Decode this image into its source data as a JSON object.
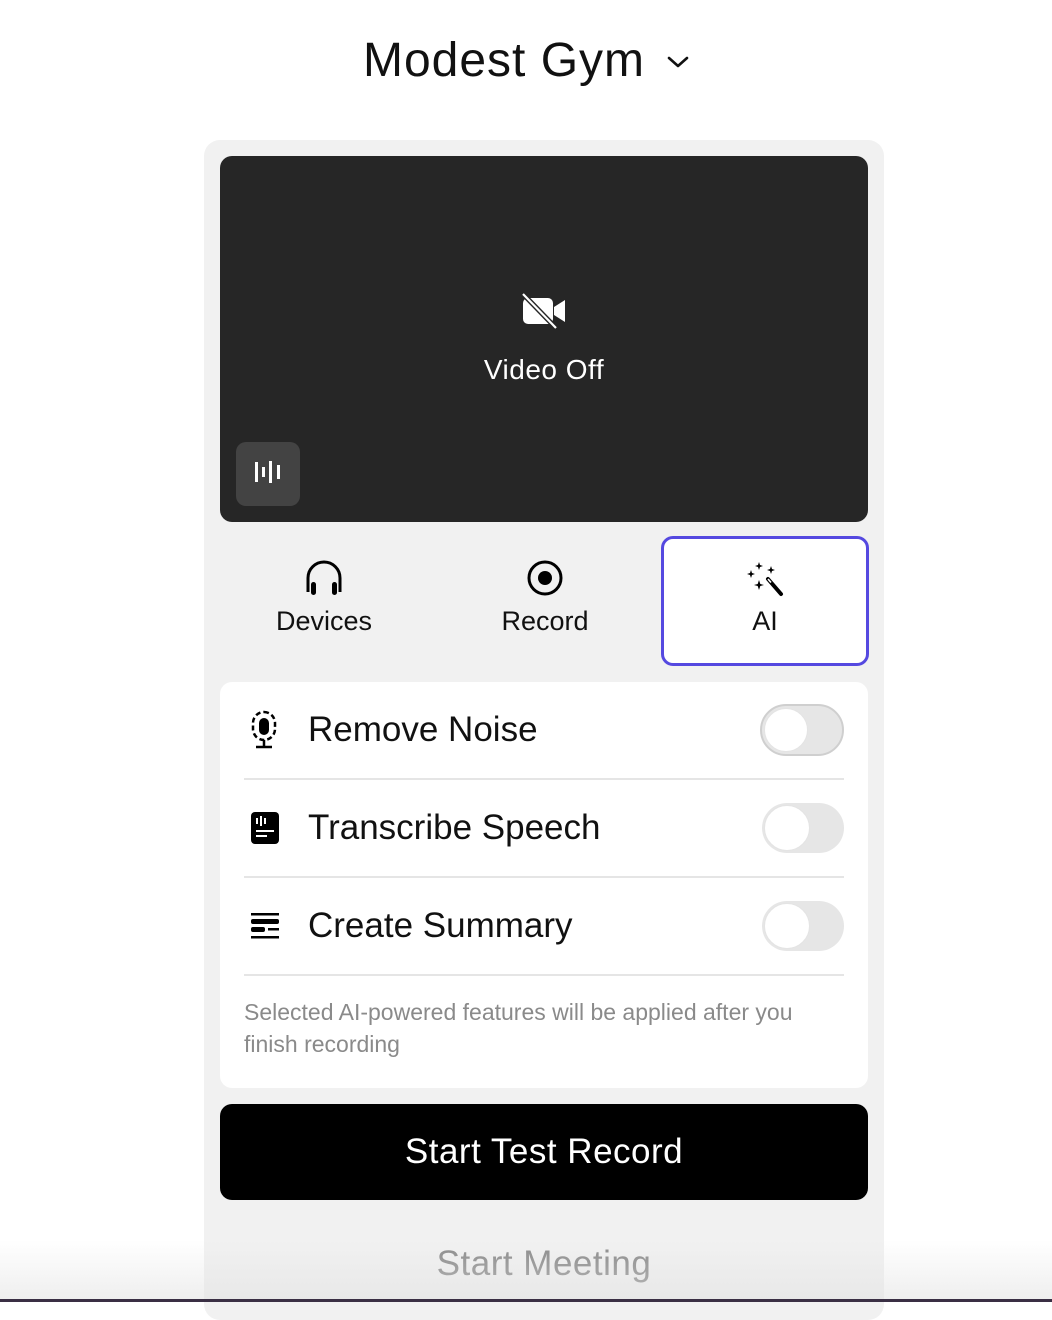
{
  "header": {
    "title": "Modest Gym",
    "dropdown_icon": "chevron-down-icon"
  },
  "video": {
    "status_label": "Video Off",
    "status_icon": "video-off-icon",
    "audio_button_icon": "audio-waveform-icon"
  },
  "tabs": [
    {
      "label": "Devices",
      "icon": "headphones-icon",
      "active": false
    },
    {
      "label": "Record",
      "icon": "record-icon",
      "active": false
    },
    {
      "label": "AI",
      "icon": "magic-wand-icon",
      "active": true
    }
  ],
  "ai_features": {
    "items": [
      {
        "label": "Remove Noise",
        "icon": "microphone-noise-icon",
        "enabled": false
      },
      {
        "label": "Transcribe Speech",
        "icon": "transcript-icon",
        "enabled": false
      },
      {
        "label": "Create Summary",
        "icon": "summary-icon",
        "enabled": false
      }
    ],
    "note": "Selected AI-powered features will be applied after you finish recording"
  },
  "actions": {
    "primary_label": "Start Test Record",
    "secondary_label": "Start Meeting"
  },
  "colors": {
    "accent": "#5549e0",
    "video_bg": "#262626",
    "panel_bg": "#f1f1f1",
    "primary_button_bg": "#000000",
    "muted_text": "#8a8a8a"
  }
}
